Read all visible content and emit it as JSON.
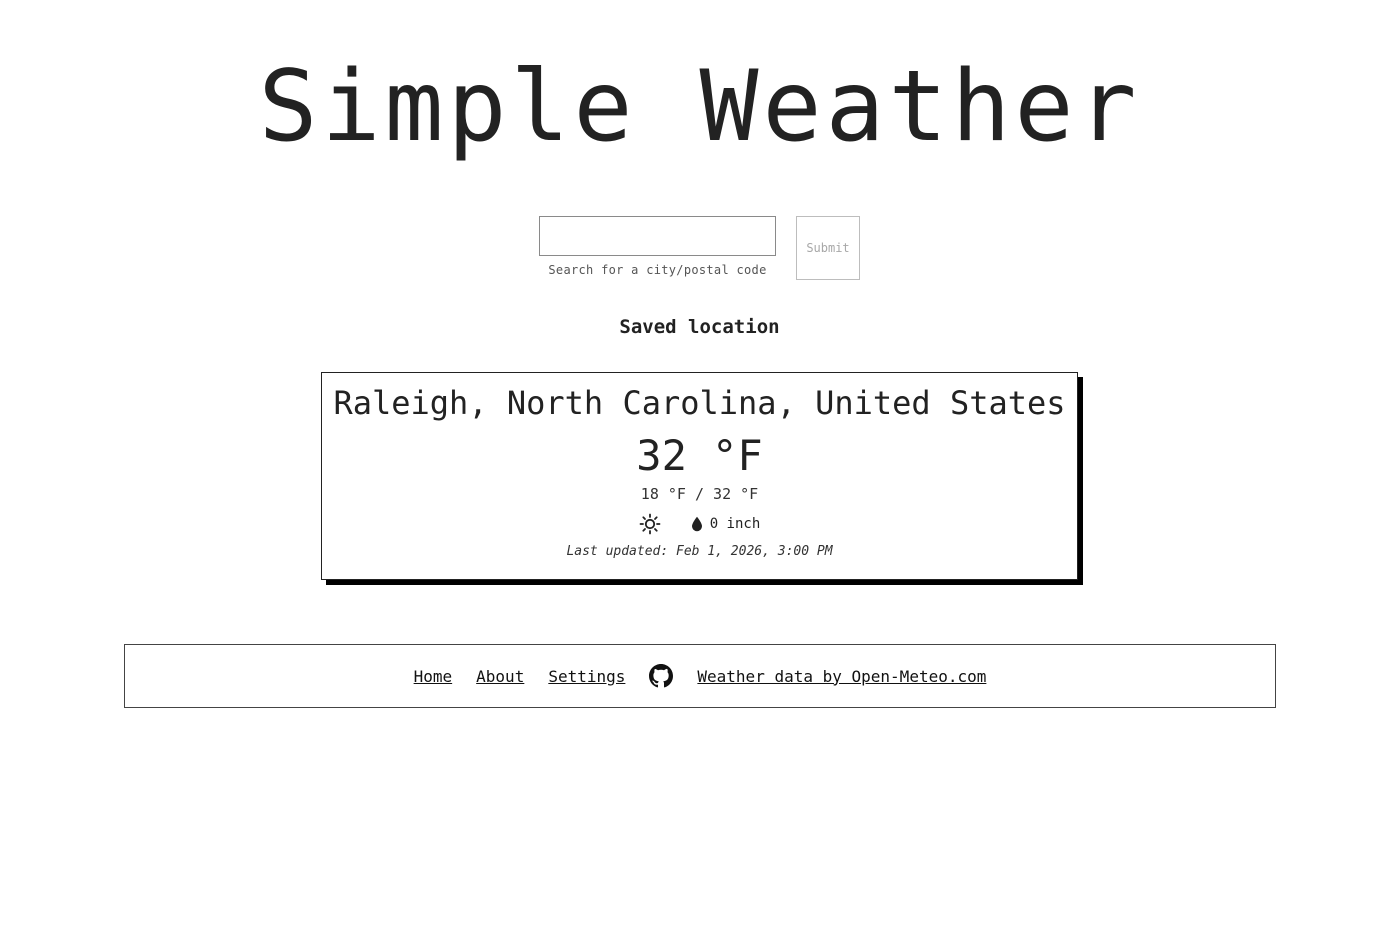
{
  "header": {
    "title": "Simple Weather"
  },
  "search": {
    "value": "",
    "placeholder": "",
    "hint": "Search for a city/postal code",
    "submit_label": "Submit"
  },
  "saved": {
    "heading": "Saved location",
    "card": {
      "location": "Raleigh, North Carolina, United States",
      "temperature": "32 °F",
      "range": "18 °F / 32 °F",
      "condition_icon": "sun-icon",
      "precip_icon": "droplet-icon",
      "precipitation": "0 inch",
      "last_updated": "Last updated: Feb 1, 2026, 3:00 PM"
    }
  },
  "footer": {
    "links": [
      {
        "label": "Home"
      },
      {
        "label": "About"
      },
      {
        "label": "Settings"
      },
      {
        "label": "Weather data by Open-Meteo.com"
      }
    ],
    "github_icon": "github-icon"
  }
}
